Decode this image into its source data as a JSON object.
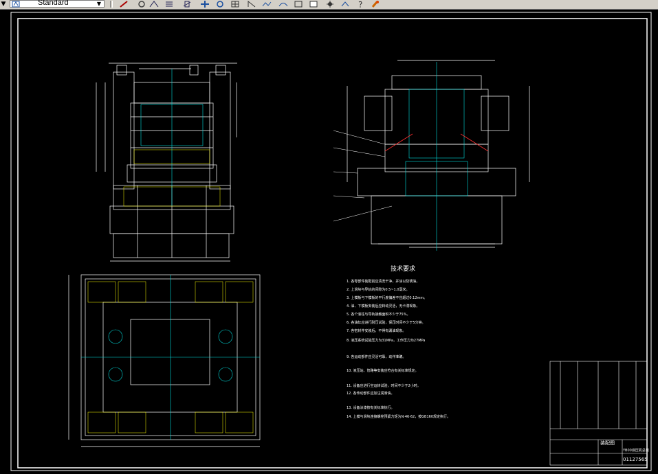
{
  "toolbar": {
    "text_style": "Standard",
    "tools": [
      "line-icon",
      "erase-icon",
      "dimension-icon",
      "layer-icon",
      "move-icon",
      "rotate-icon",
      "grid-icon",
      "measure-icon",
      "polyline-icon",
      "curve-icon",
      "rectangle-icon",
      "block-icon",
      "settings-icon",
      "snap-icon",
      "help-icon",
      "paint-icon"
    ]
  },
  "drawing": {
    "notes_title": "技术要求",
    "notes": [
      "1. 各零部件装配前应清洗干净，并涂以防锈油。",
      "2. 上滑块与导轨的间隙为0.5~1.0毫米。",
      "3. 上模板与下模板的平行度偏差不应超过0.12mm。",
      "4. 油、下模板安装后应转动灵活，无卡滞现象。",
      "5. 各个滚柱与导轨接触面积不少于75%。",
      "6. 各油缸应进行耐压试验，保压时间不少于5分钟。",
      "7. 各密封件安装后，不得有漏油现象。",
      "8. 液压系统试验压力为31MPa，工作压力为27MPa",
      "9. 各运动部件应灵活可靠，动作准确。",
      "10. 液压站、管路等安装应符合有关标准规定。",
      "11. 设备应进行空运转试验，时间不少于2小时。",
      "12. 各传动部件应加注润滑油。",
      "13. 设备涂漆按有关标准执行。",
      "14. 上模与滑块连接螺栓预紧力矩为N·46·62，按GB160规定执行。"
    ],
    "title_block": {
      "name": "装配图",
      "title": "YB00液压机总装",
      "number": "01127565"
    }
  }
}
